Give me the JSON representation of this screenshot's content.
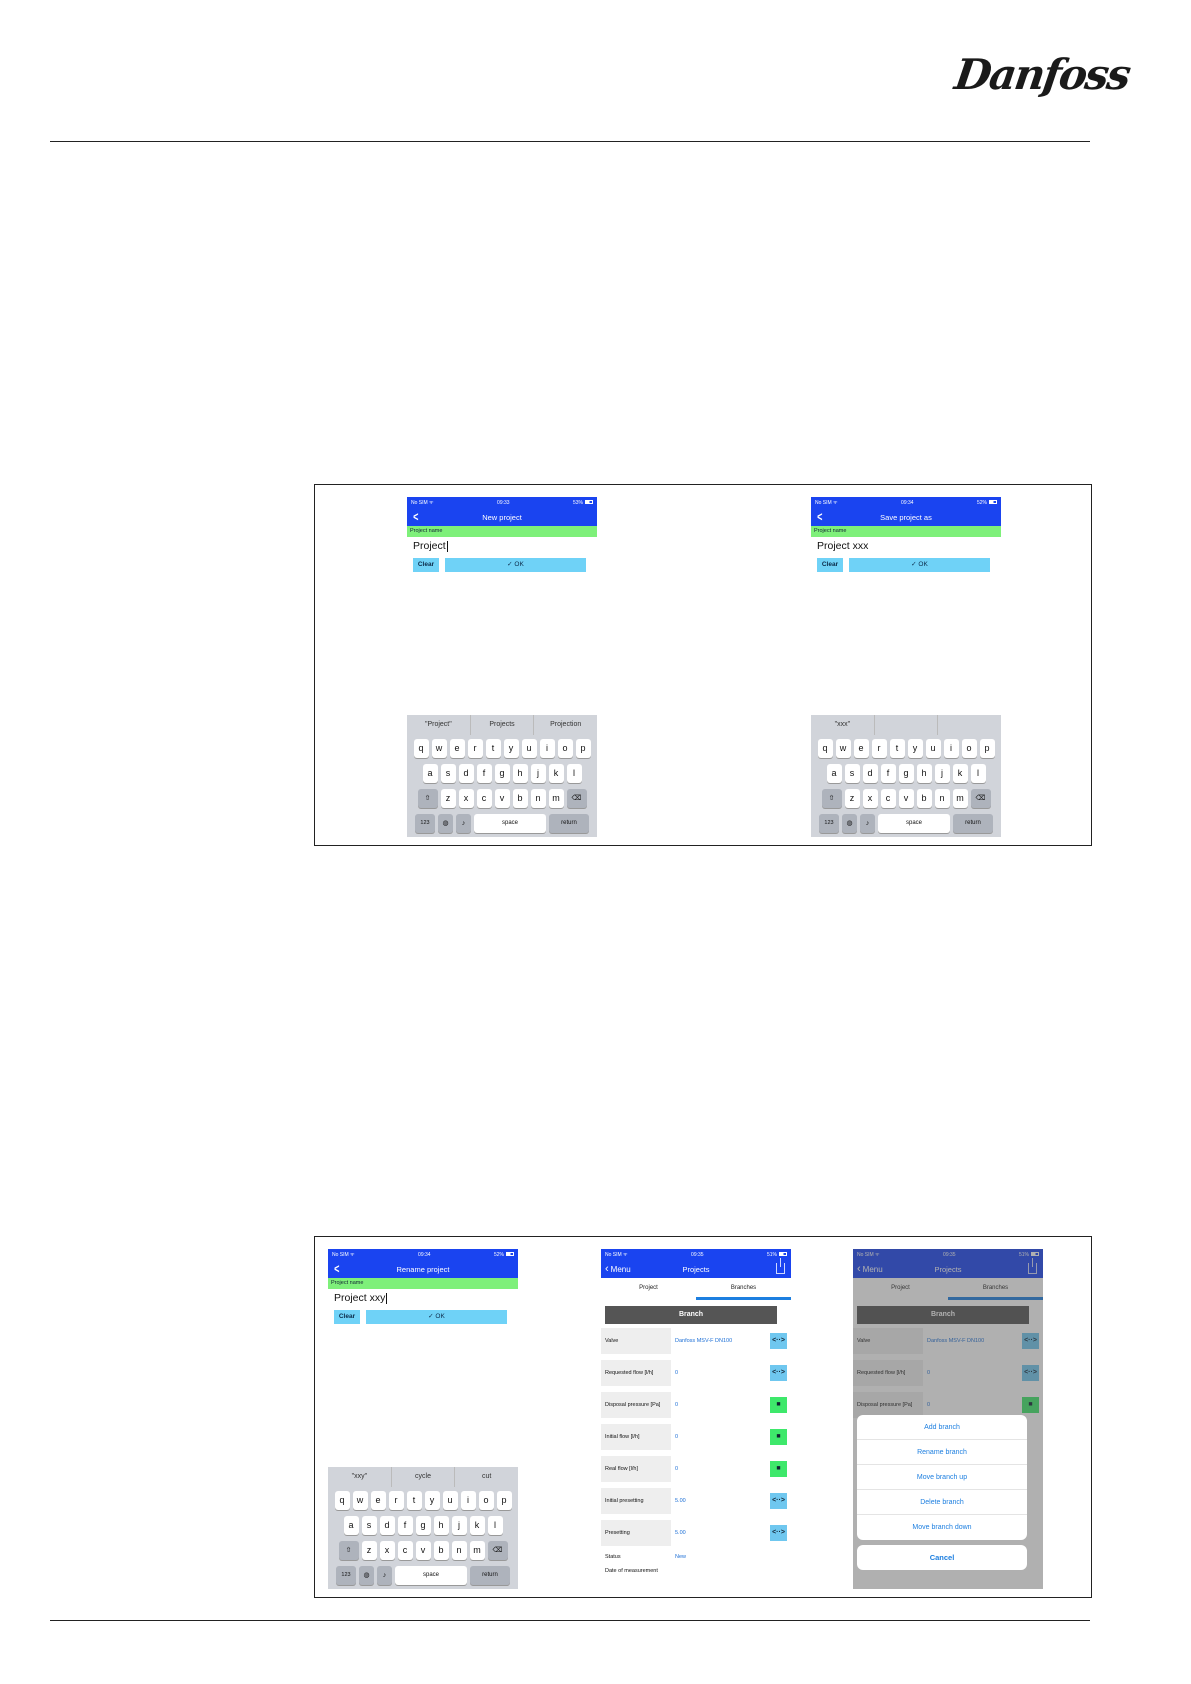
{
  "brand": {
    "logo_text": "Danfoss"
  },
  "status_bar": {
    "carrier": "No SIM"
  },
  "screens": {
    "new_project": {
      "time": "09:33",
      "battery": "53%",
      "title": "New project",
      "field_label": "Project name",
      "input_value": "Project",
      "clear_label": "Clear",
      "ok_label": "✓ OK",
      "suggestions": [
        "\"Project\"",
        "Projects",
        "Projection"
      ]
    },
    "save_project_as": {
      "time": "09:34",
      "battery": "52%",
      "title": "Save project as",
      "field_label": "Project name",
      "input_value": "Project xxx",
      "clear_label": "Clear",
      "ok_label": "✓ OK",
      "suggestions": [
        "\"xxx\"",
        "",
        ""
      ]
    },
    "rename_project": {
      "time": "09:34",
      "battery": "52%",
      "title": "Rename project",
      "field_label": "Project name",
      "input_value": "Project xxy",
      "clear_label": "Clear",
      "ok_label": "✓ OK",
      "suggestions": [
        "\"xxy\"",
        "cycle",
        "cut"
      ]
    },
    "projects": {
      "time": "09:35",
      "battery": "51%",
      "back_label": "Menu",
      "title": "Projects",
      "tabs": [
        "Project",
        "Branches"
      ],
      "branch_header": "Branch",
      "rows": [
        {
          "label": "Valve",
          "value": "Danfoss MSV-F  DN100",
          "icon": "↔",
          "icon_color": "blue"
        },
        {
          "label": "Requested flow [l/h]",
          "value": "0",
          "icon": "↔",
          "icon_color": "blue"
        },
        {
          "label": "Disposal pressure [Pa]",
          "value": "0",
          "icon": "tag",
          "icon_color": "green"
        },
        {
          "label": "Initial flow [l/h]",
          "value": "0",
          "icon": "tag",
          "icon_color": "green"
        },
        {
          "label": "Real flow [l/h]",
          "value": "0",
          "icon": "tag",
          "icon_color": "green"
        },
        {
          "label": "Initial presetting",
          "value": "5.00",
          "icon": "↔",
          "icon_color": "blue"
        },
        {
          "label": "Presetting",
          "value": "5.00",
          "icon": "↔",
          "icon_color": "blue"
        }
      ],
      "status_label": "Status",
      "status_value": "New",
      "date_label": "Date of measurement"
    },
    "projects_menu": {
      "time": "09:35",
      "battery": "51%",
      "back_label": "Menu",
      "title": "Projects",
      "tabs": [
        "Project",
        "Branches"
      ],
      "branch_header": "Branch",
      "rows": [
        {
          "label": "Valve",
          "value": "Danfoss MSV-F  DN100"
        },
        {
          "label": "Requested flow [l/h]",
          "value": "0"
        },
        {
          "label": "Disposal pressure [Pa]",
          "value": "0"
        }
      ],
      "actions": [
        "Add branch",
        "Rename branch",
        "Move branch up",
        "Delete branch",
        "Move branch down"
      ],
      "cancel_label": "Cancel"
    }
  },
  "keyboard": {
    "row1": [
      "q",
      "w",
      "e",
      "r",
      "t",
      "y",
      "u",
      "i",
      "o",
      "p"
    ],
    "row2": [
      "a",
      "s",
      "d",
      "f",
      "g",
      "h",
      "j",
      "k",
      "l"
    ],
    "row3": [
      "z",
      "x",
      "c",
      "v",
      "b",
      "n",
      "m"
    ],
    "num_key": "123",
    "space_key": "space",
    "return_key": "return"
  }
}
